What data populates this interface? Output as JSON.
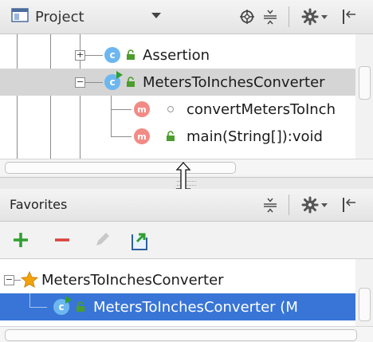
{
  "project_panel": {
    "title": "Project",
    "tree": [
      {
        "name": "Assertion",
        "icon": "class-icon"
      },
      {
        "name": "MetersToInchesConverter",
        "icon": "runnable-class-icon"
      },
      {
        "name": "convertMetersToInch",
        "icon": "method-icon"
      },
      {
        "name": "main(String[]):void",
        "icon": "method-icon"
      }
    ]
  },
  "favorites_panel": {
    "title": "Favorites",
    "tree": [
      {
        "name": "MetersToInchesConverter",
        "icon": "star-icon"
      },
      {
        "name": "MetersToInchesConverter (M",
        "icon": "runnable-class-icon"
      }
    ]
  },
  "colors": {
    "add": "#2fa02f",
    "remove": "#d9413a",
    "selection": "#3875d7",
    "class_icon": "#6db7f0",
    "method_icon": "#f28b86",
    "lock": "#4c9c2e"
  }
}
